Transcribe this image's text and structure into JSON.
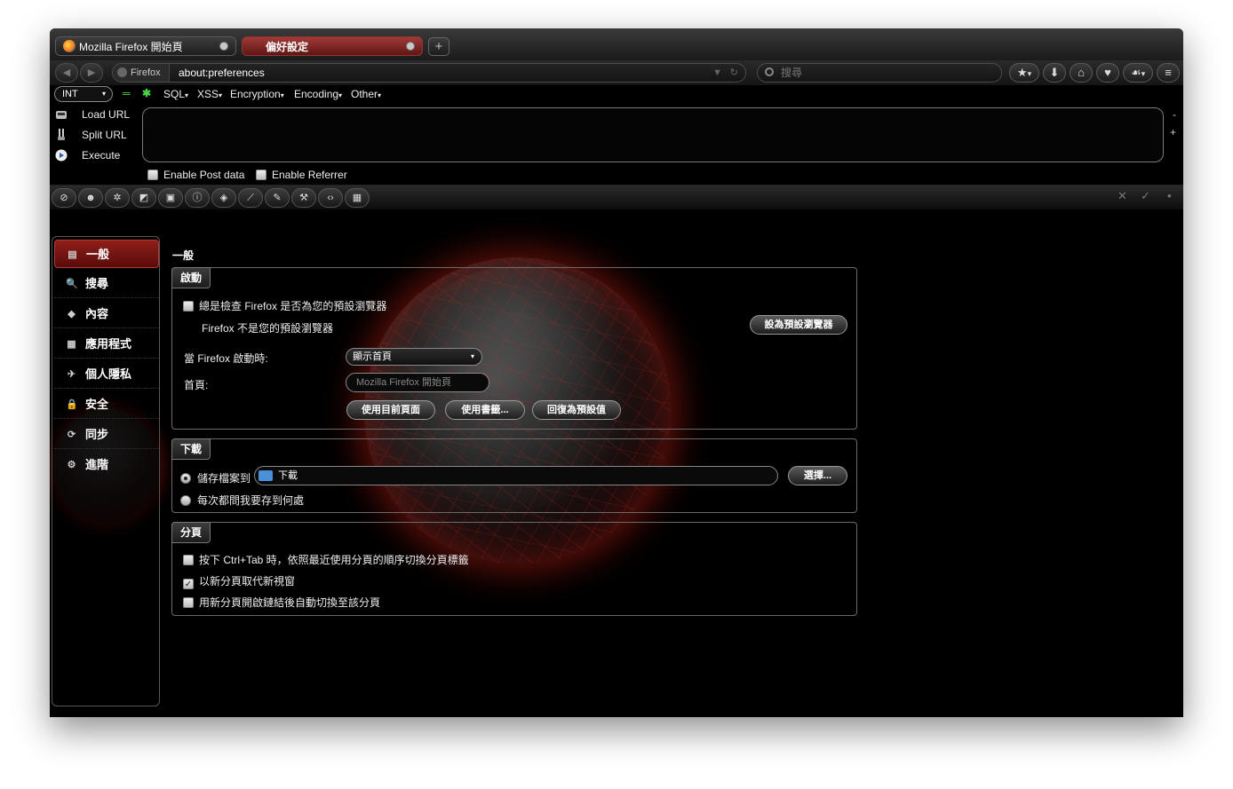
{
  "window": {
    "tabs": [
      {
        "title": "Mozilla Firefox 開始頁"
      },
      {
        "title": "偏好設定"
      }
    ],
    "newtab_symbol": "+"
  },
  "nav": {
    "back_icon": "◀",
    "forward_icon": "▶",
    "identity_label": "Firefox",
    "url": "about:preferences",
    "url_dropdown_icon": "▼",
    "reload_icon": "↻",
    "search_placeholder": "搜尋",
    "bookmark_icon": "★",
    "bookmark_menu_icon": "▾",
    "download_icon": "⬇",
    "home_icon": "⌂",
    "pocket_icon": "♥",
    "extension_icon": "☙",
    "extension_menu_icon": "▾",
    "menu_icon": "≡"
  },
  "hackbar": {
    "int_select": "INT",
    "int_arrow": "▾",
    "icon_minus": "═",
    "icon_plus": "✱",
    "menus": [
      "SQL",
      "XSS",
      "Encryption",
      "Encoding",
      "Other"
    ],
    "menu_caret": "▾",
    "actions": [
      {
        "label": "Load URL"
      },
      {
        "label": "Split URL"
      },
      {
        "label": "Execute"
      }
    ],
    "minus": "-",
    "plus": "+",
    "enable_post": "Enable Post data",
    "enable_referrer": "Enable Referrer"
  },
  "icon_toolbar": {
    "buttons": [
      "⊘",
      "☻",
      "✲",
      "◩",
      "▣",
      "ⓘ",
      "◈",
      "⟋",
      "✎",
      "⚒",
      "‹›",
      "▦"
    ],
    "right": [
      "✕",
      "✓",
      "•"
    ]
  },
  "sidebar": {
    "categories": [
      {
        "label": "一般",
        "icon": "▤"
      },
      {
        "label": "搜尋",
        "icon": "🔍"
      },
      {
        "label": "內容",
        "icon": "◆"
      },
      {
        "label": "應用程式",
        "icon": "▦"
      },
      {
        "label": "個人隱私",
        "icon": "✈"
      },
      {
        "label": "安全",
        "icon": "🔒"
      },
      {
        "label": "同步",
        "icon": "⟳"
      },
      {
        "label": "進階",
        "icon": "⚙"
      }
    ]
  },
  "pane": {
    "title": "一般",
    "startup": {
      "caption": "啟動",
      "check_default": "總是檢查 Firefox 是否為您的預設瀏覽器",
      "not_default": "Firefox 不是您的預設瀏覽器",
      "set_default_button": "設為預設瀏覽器",
      "when_starts_label": "當 Firefox 啟動時:",
      "when_starts_value": "顯示首頁",
      "select_arrow": "▾",
      "homepage_label": "首頁:",
      "homepage_placeholder": "Mozilla Firefox 開始頁",
      "use_current": "使用目前頁面",
      "use_bookmark": "使用書籤...",
      "restore_default": "回復為預設值"
    },
    "downloads": {
      "caption": "下載",
      "save_to": "儲存檔案到",
      "folder": "下載",
      "choose_button": "選擇...",
      "always_ask": "每次都問我要存到何處"
    },
    "tabs": {
      "caption": "分頁",
      "ctrl_tab": "按下 Ctrl+Tab 時，依照最近使用分頁的順序切換分頁標籤",
      "ctrl_tab_checked": false,
      "new_windows_in_tabs": "以新分頁取代新視窗",
      "new_windows_in_tabs_checked": true,
      "switch_to_new": "用新分頁開啟鏈結後自動切換至該分頁",
      "switch_to_new_checked": false
    }
  },
  "colors": {
    "accent_red": "#8e1e1a",
    "orb_glow": "#b41e14"
  }
}
